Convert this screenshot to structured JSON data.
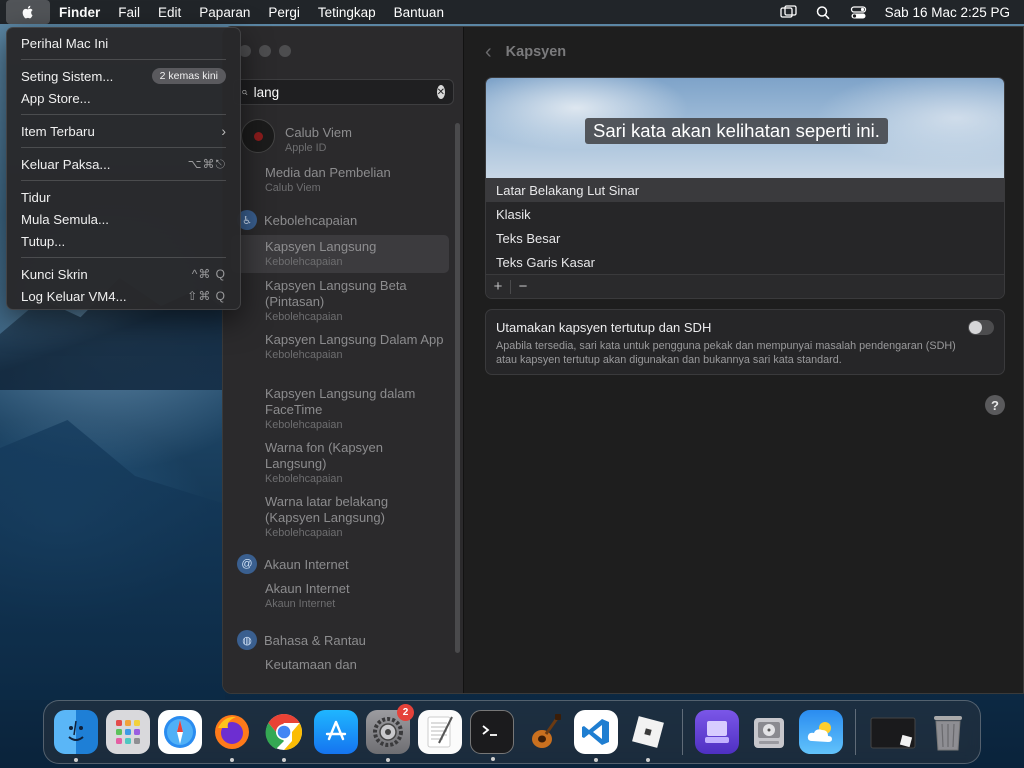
{
  "menubar": {
    "items": [
      "Finder",
      "Fail",
      "Edit",
      "Paparan",
      "Pergi",
      "Tetingkap",
      "Bantuan"
    ],
    "clock": "Sab 16 Mac  2:25 PG"
  },
  "apple_menu": {
    "about": "Perihal Mac Ini",
    "settings": "Seting Sistem...",
    "settings_badge": "2 kemas kini",
    "app_store": "App Store...",
    "recent": "Item Terbaru",
    "force_quit": "Keluar Paksa...",
    "force_quit_shortcut": "⌥⌘⎋",
    "sleep": "Tidur",
    "restart": "Mula Semula...",
    "shutdown": "Tutup...",
    "lock": "Kunci Skrin",
    "lock_shortcut": "^⌘ Q",
    "logout": "Log Keluar VM4...",
    "logout_shortcut": "⇧⌘ Q"
  },
  "search": {
    "value": "lang"
  },
  "sidebar": {
    "account_name": "Calub Viem",
    "account_sub": "Apple ID",
    "media_title": "Media dan Pembelian",
    "media_sub": "Calub Viem",
    "cat_accessibility": "Kebolehcapaian",
    "results": [
      {
        "title": "Kapsyen Langsung",
        "sub": "Kebolehcapaian"
      },
      {
        "title": "Kapsyen Langsung Beta (Pintasan)",
        "sub": "Kebolehcapaian"
      },
      {
        "title": "Kapsyen Langsung Dalam App",
        "sub": "Kebolehcapaian"
      },
      {
        "title": "Kapsyen Langsung dalam FaceTime",
        "sub": "Kebolehcapaian"
      },
      {
        "title": "Warna fon (Kapsyen Langsung)",
        "sub": "Kebolehcapaian"
      },
      {
        "title": "Warna latar belakang (Kapsyen Langsung)",
        "sub": "Kebolehcapaian"
      }
    ],
    "cat_internet": "Akaun Internet",
    "internet_title": "Akaun Internet",
    "internet_sub": "Akaun Internet",
    "cat_language": "Bahasa & Rantau",
    "language_title": "Keutamaan dan"
  },
  "content": {
    "title": "Kapsyen",
    "preview_text": "Sari kata akan kelihatan seperti ini.",
    "styles": [
      "Latar Belakang Lut Sinar",
      "Klasik",
      "Teks Besar",
      "Teks Garis Kasar"
    ],
    "add": "+",
    "remove": "−",
    "sdh_title": "Utamakan kapsyen tertutup dan SDH",
    "sdh_desc": "Apabila tersedia, sari kata untuk pengguna pekak dan mempunyai masalah pendengaran (SDH) atau kapsyen tertutup akan digunakan dan bukannya sari kata standard.",
    "help": "?"
  },
  "dock": {
    "settings_badge": "2"
  }
}
